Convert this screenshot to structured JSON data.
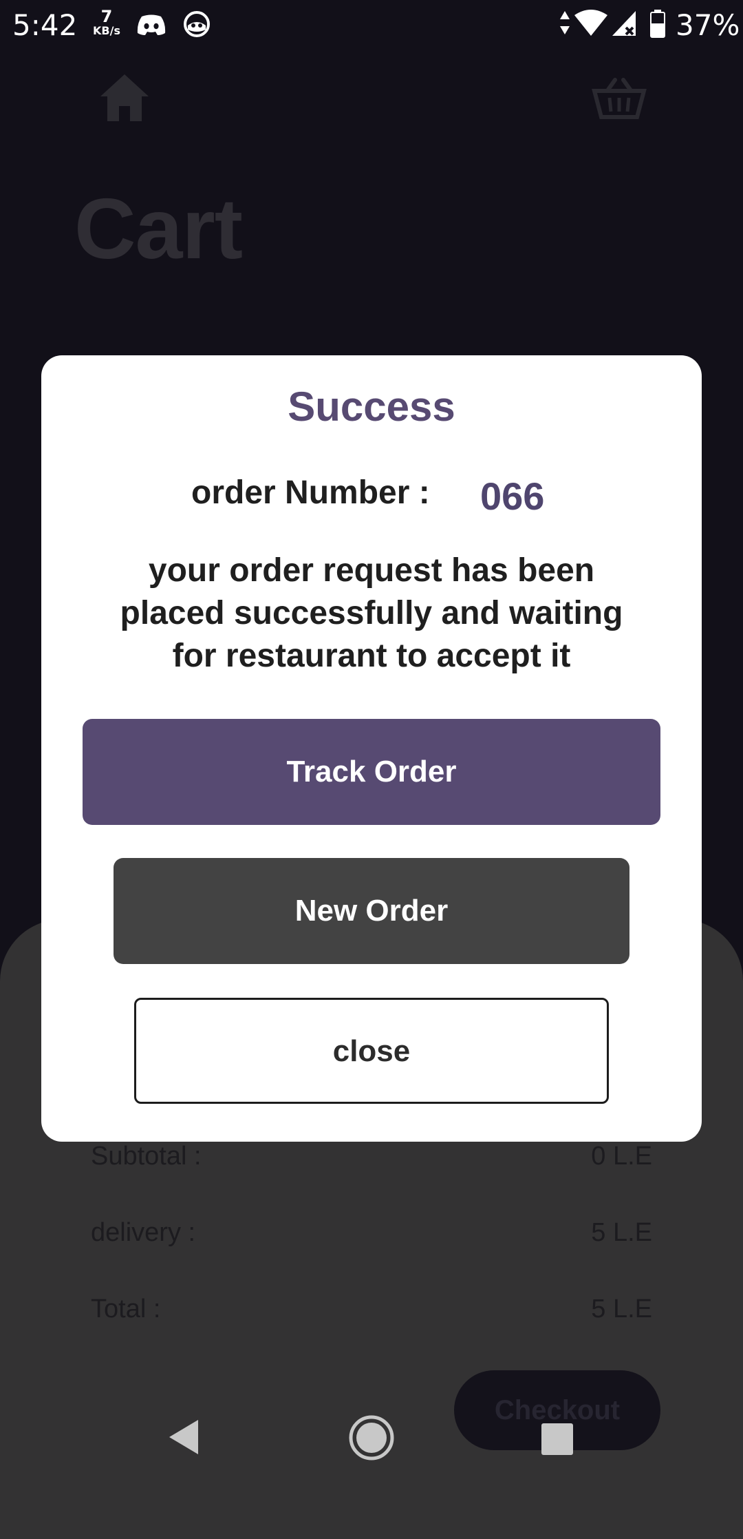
{
  "status_bar": {
    "time": "5:42",
    "net_speed_value": "7",
    "net_speed_unit": "KB/s",
    "battery": "37%"
  },
  "background": {
    "page_title": "Cart",
    "summary": [
      {
        "label": "Subtotal :",
        "value": "0 L.E"
      },
      {
        "label": "delivery :",
        "value": "5 L.E"
      },
      {
        "label": "Total :",
        "value": "5 L.E"
      }
    ],
    "checkout_label": "Checkout"
  },
  "dialog": {
    "title": "Success",
    "order_label": "order Number :",
    "order_number": "066",
    "message": "your order request has been placed successfully and waiting for restaurant to accept it",
    "track_label": "Track Order",
    "new_label": "New Order",
    "close_label": "close"
  },
  "colors": {
    "accent": "#574a72",
    "backdrop": "#121019",
    "sheet": "#333233",
    "new_order_button": "#434343"
  },
  "icons": [
    "discord-icon",
    "ghost-app-icon",
    "data-arrows-icon",
    "wifi-icon",
    "cell-signal-icon",
    "battery-icon",
    "home-icon",
    "basket-icon",
    "back-icon",
    "home-nav-icon",
    "recents-icon"
  ]
}
